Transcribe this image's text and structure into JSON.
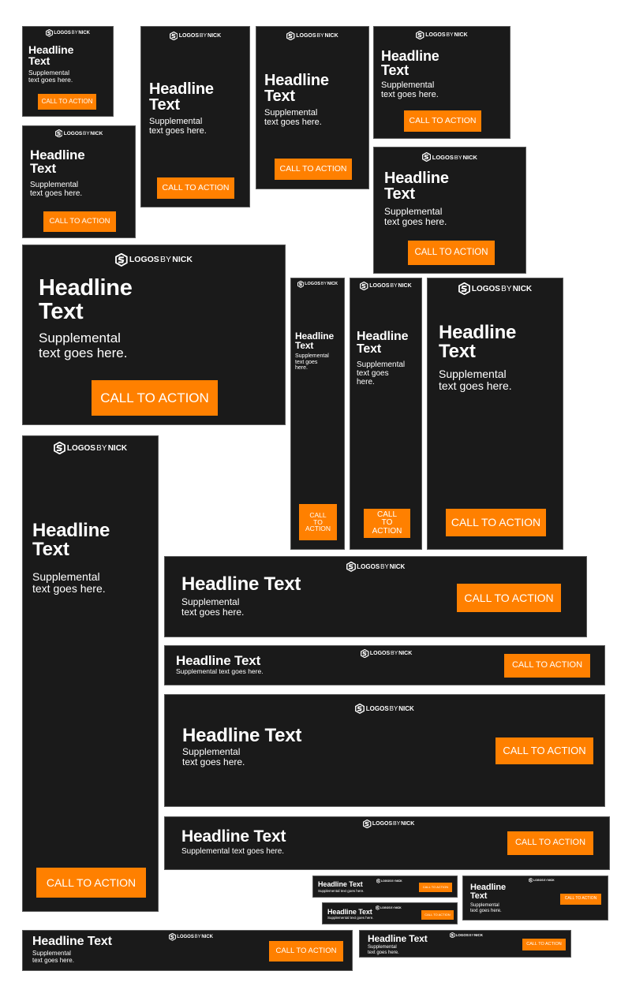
{
  "colors": {
    "background": "#1a1a1a",
    "accent": "#ff8000",
    "text": "#ffffff",
    "border": "#5a5a5a"
  },
  "logo": {
    "icon": "hexagon-s-logo-icon",
    "part1": "LOGOS",
    "part2": "BY",
    "part3": "NICK"
  },
  "banner_text": {
    "headline": "Headline Text",
    "supplemental": "Supplemental text goes here.",
    "cta": "CALL TO ACTION"
  }
}
